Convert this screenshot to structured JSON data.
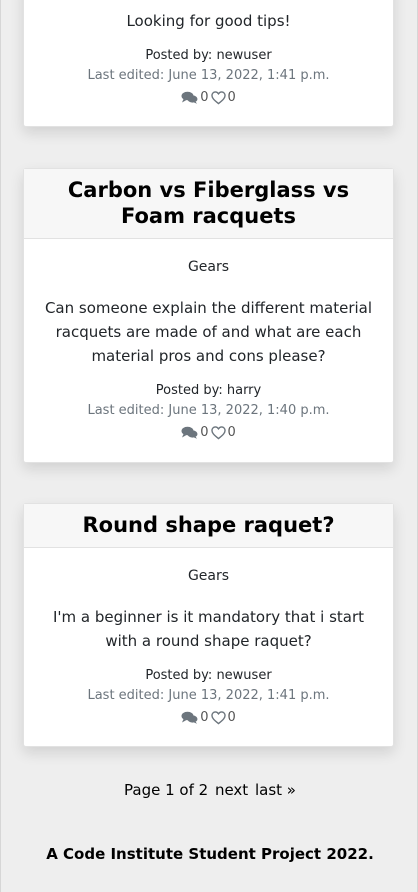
{
  "posts": [
    {
      "title": "",
      "category": "",
      "content": "Looking for good tips!",
      "posted_label": "Posted by:",
      "author": "newuser",
      "edited_label": "Last edited:",
      "edited": "June 13, 2022, 1:41 p.m.",
      "comments": "0",
      "likes": "0"
    },
    {
      "title": "Carbon vs Fiberglass vs Foam racquets",
      "category": "Gears",
      "content": "Can someone explain the different material racquets are made of and what are each material pros and cons please?",
      "posted_label": "Posted by:",
      "author": "harry",
      "edited_label": "Last edited:",
      "edited": "June 13, 2022, 1:40 p.m.",
      "comments": "0",
      "likes": "0"
    },
    {
      "title": "Round shape raquet?",
      "category": "Gears",
      "content": "I'm a beginner is it mandatory that i start with a round shape raquet?",
      "posted_label": "Posted by:",
      "author": "newuser",
      "edited_label": "Last edited:",
      "edited": "June 13, 2022, 1:41 p.m.",
      "comments": "0",
      "likes": "0"
    }
  ],
  "pagination": {
    "page_text": "Page 1 of 2",
    "next": "next",
    "last": "last »"
  },
  "footer": {
    "text": "A Code Institute Student Project 2022."
  },
  "icons": {
    "comments": "comments-icon",
    "likes": "heart-icon"
  }
}
